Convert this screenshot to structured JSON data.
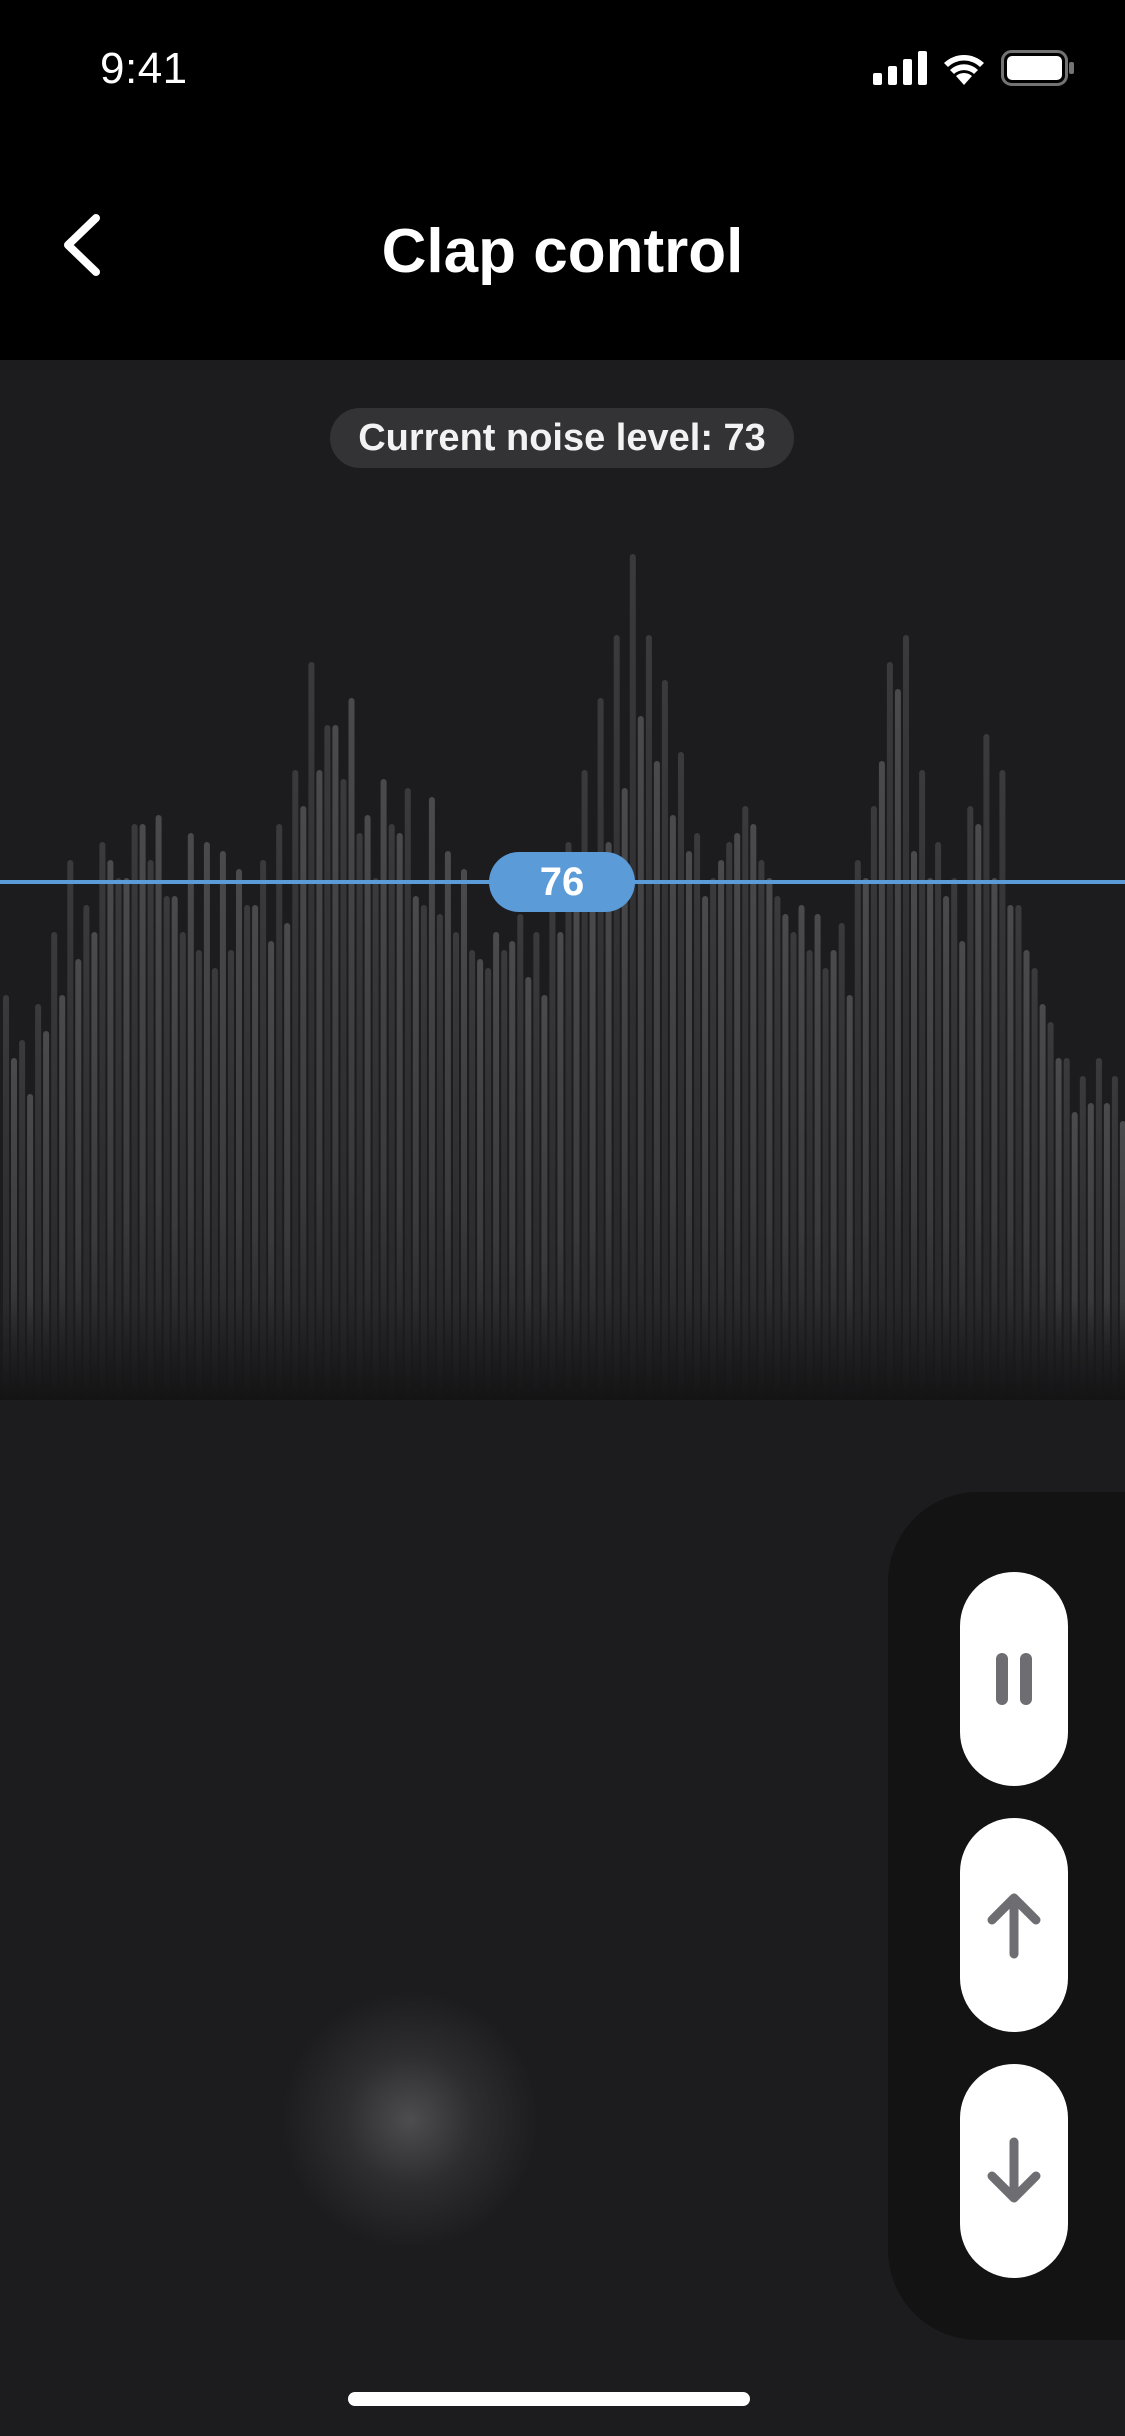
{
  "status_bar": {
    "time": "9:41",
    "icons": [
      "cellular-signal-icon",
      "wifi-icon",
      "battery-icon"
    ]
  },
  "nav": {
    "title": "Clap control",
    "back_icon": "chevron-left-icon"
  },
  "noise": {
    "label": "Current noise level: 73",
    "current_level": 73
  },
  "threshold": {
    "value": "76"
  },
  "meter": {
    "bar_levels": [
      0.38,
      0.34,
      0.41,
      0.45,
      0.49,
      0.52,
      0.6,
      0.58,
      0.64,
      0.65,
      0.56,
      0.63,
      0.62,
      0.61,
      0.59,
      0.55,
      0.51,
      0.53,
      0.66,
      0.7,
      0.75,
      0.78,
      0.65,
      0.69,
      0.63,
      0.56,
      0.67,
      0.61,
      0.59,
      0.49,
      0.52,
      0.51,
      0.47,
      0.45,
      0.52,
      0.55,
      0.56,
      0.62,
      0.68,
      0.76,
      0.71,
      0.65,
      0.61,
      0.56,
      0.6,
      0.63,
      0.64,
      0.58,
      0.54,
      0.55,
      0.54,
      0.5,
      0.45,
      0.58,
      0.71,
      0.79,
      0.61,
      0.58,
      0.56,
      0.51,
      0.64,
      0.58,
      0.55,
      0.5,
      0.44,
      0.38,
      0.32,
      0.33,
      0.33,
      0.31
    ],
    "ghost_levels": [
      0.45,
      0.4,
      0.44,
      0.52,
      0.6,
      0.55,
      0.62,
      0.58,
      0.64,
      0.6,
      0.56,
      0.52,
      0.5,
      0.48,
      0.5,
      0.55,
      0.6,
      0.64,
      0.7,
      0.82,
      0.75,
      0.69,
      0.63,
      0.58,
      0.64,
      0.68,
      0.55,
      0.54,
      0.52,
      0.5,
      0.48,
      0.5,
      0.54,
      0.52,
      0.56,
      0.62,
      0.7,
      0.78,
      0.85,
      0.94,
      0.85,
      0.8,
      0.72,
      0.63,
      0.58,
      0.62,
      0.66,
      0.6,
      0.56,
      0.52,
      0.5,
      0.48,
      0.53,
      0.6,
      0.66,
      0.82,
      0.85,
      0.7,
      0.62,
      0.58,
      0.66,
      0.74,
      0.7,
      0.55,
      0.48,
      0.42,
      0.38,
      0.36,
      0.38,
      0.36
    ]
  },
  "controls": {
    "pause": "pause-icon",
    "up": "arrow-up-icon",
    "down": "arrow-down-icon"
  },
  "colors": {
    "accent": "#5b9bd8",
    "background": "#1c1c1e",
    "header": "#000000",
    "panel": "#131314"
  }
}
